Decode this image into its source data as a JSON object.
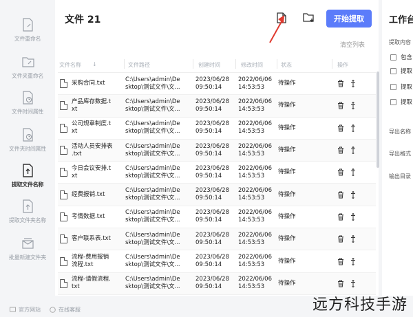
{
  "sidebar": {
    "items": [
      {
        "label": "文件重命名",
        "icon": "file-rename-icon"
      },
      {
        "label": "文件夹重命名",
        "icon": "folder-rename-icon"
      },
      {
        "label": "文件时间属性",
        "icon": "file-time-icon"
      },
      {
        "label": "文件夹时间属性",
        "icon": "folder-time-icon"
      },
      {
        "label": "提取文件名称",
        "icon": "extract-file-icon",
        "active": true
      },
      {
        "label": "提取文件夹名称",
        "icon": "extract-folder-icon"
      },
      {
        "label": "批量新建文件夹",
        "icon": "batch-folder-icon"
      }
    ]
  },
  "header": {
    "title": "文件 21",
    "start_label": "开始提取",
    "clear_label": "清空列表"
  },
  "table": {
    "columns": [
      "文件名称",
      "文件路径",
      "创建时间",
      "修改时间",
      "状态",
      "操作"
    ],
    "rows": [
      {
        "name": [
          "采购合同.txt"
        ],
        "path": [
          "C:\\Users\\admin\\De",
          "sktop\\测试文件\\文..."
        ],
        "created": [
          "2023/06/28",
          "09:50:14"
        ],
        "modified": [
          "2022/06/06",
          "14:53:53"
        ],
        "status": "待操作"
      },
      {
        "name": [
          "产品库存数据.t",
          "xt"
        ],
        "path": [
          "C:\\Users\\admin\\De",
          "sktop\\测试文件\\文..."
        ],
        "created": [
          "2023/06/28",
          "09:50:14"
        ],
        "modified": [
          "2022/06/06",
          "14:53:53"
        ],
        "status": "待操作"
      },
      {
        "name": [
          "公司规章制度.t",
          "xt"
        ],
        "path": [
          "C:\\Users\\admin\\De",
          "sktop\\测试文件\\文..."
        ],
        "created": [
          "2023/06/28",
          "09:50:14"
        ],
        "modified": [
          "2022/06/06",
          "14:53:53"
        ],
        "status": "待操作"
      },
      {
        "name": [
          "活动人员安排表",
          ".txt"
        ],
        "path": [
          "C:\\Users\\admin\\De",
          "sktop\\测试文件\\文..."
        ],
        "created": [
          "2023/06/28",
          "09:50:14"
        ],
        "modified": [
          "2022/06/06",
          "14:53:53"
        ],
        "status": "待操作"
      },
      {
        "name": [
          "今日会议安排.t",
          "xt"
        ],
        "path": [
          "C:\\Users\\admin\\De",
          "sktop\\测试文件\\文..."
        ],
        "created": [
          "2023/06/28",
          "09:50:14"
        ],
        "modified": [
          "2022/06/06",
          "14:53:53"
        ],
        "status": "待操作"
      },
      {
        "name": [
          "经费报销.txt"
        ],
        "path": [
          "C:\\Users\\admin\\De",
          "sktop\\测试文件\\文..."
        ],
        "created": [
          "2023/06/28",
          "09:50:14"
        ],
        "modified": [
          "2022/06/06",
          "14:53:53"
        ],
        "status": "待操作"
      },
      {
        "name": [
          "考情数据.txt"
        ],
        "path": [
          "C:\\Users\\admin\\De",
          "sktop\\测试文件\\文..."
        ],
        "created": [
          "2023/06/28",
          "09:50:14"
        ],
        "modified": [
          "2022/06/06",
          "14:53:53"
        ],
        "status": "待操作"
      },
      {
        "name": [
          "客户联系表.txt"
        ],
        "path": [
          "C:\\Users\\admin\\De",
          "sktop\\测试文件\\文..."
        ],
        "created": [
          "2023/06/28",
          "09:50:14"
        ],
        "modified": [
          "2022/06/06",
          "14:53:53"
        ],
        "status": "待操作"
      },
      {
        "name": [
          "流程-费用报销",
          "流程.txt"
        ],
        "path": [
          "C:\\Users\\admin\\De",
          "sktop\\测试文件\\文..."
        ],
        "created": [
          "2023/06/28",
          "09:50:14"
        ],
        "modified": [
          "2022/06/06",
          "14:53:53"
        ],
        "status": "待操作"
      },
      {
        "name": [
          "流程-请假流程.",
          "txt"
        ],
        "path": [
          "C:\\Users\\admin\\De",
          "sktop\\测试文件\\文..."
        ],
        "created": [
          "2023/06/28",
          "09:50:14"
        ],
        "modified": [
          "2022/06/06",
          "14:53:53"
        ],
        "status": "待操作"
      }
    ]
  },
  "right_panel": {
    "title": "工作台",
    "extract_label": "提取内容",
    "checks": [
      "包含",
      "提取",
      "提取",
      "提取"
    ],
    "export_name": "导出名称",
    "export_format": "导出格式",
    "output_dir": "输出目录"
  },
  "footer": {
    "website": "官方网站",
    "support": "在线客服"
  },
  "watermark": "远方科技手游",
  "colors": {
    "accent": "#5b7cfa",
    "arrow": "#e03a2f"
  }
}
